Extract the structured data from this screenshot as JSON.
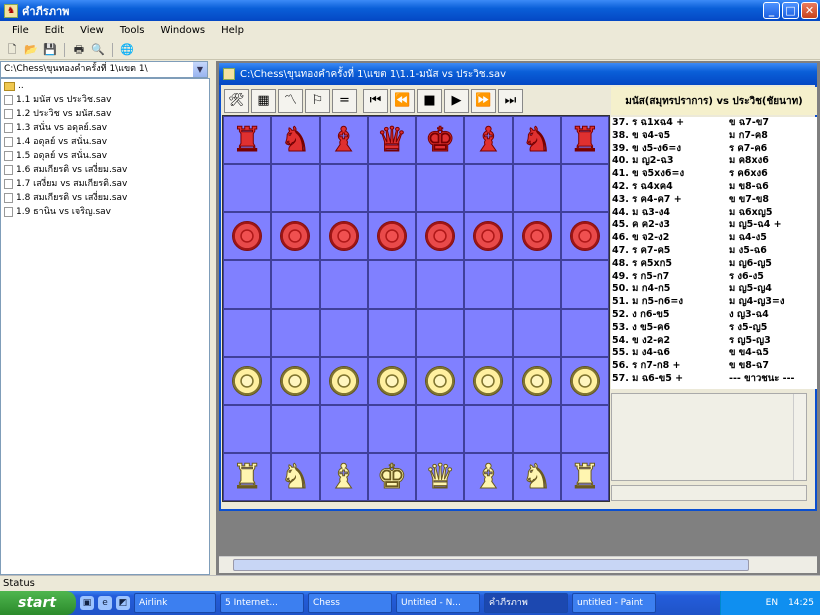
{
  "window": {
    "title": "คำภีรภาพ"
  },
  "menu": [
    "File",
    "Edit",
    "View",
    "Tools",
    "Windows",
    "Help"
  ],
  "left_pane": {
    "path": "C:\\Chess\\ขุนทองคำครั้งที่ 1\\แขต 1\\",
    "files": [
      {
        "name": "..",
        "icon": "folder-up-icon"
      },
      {
        "name": "1.1 มนัส vs ประวิช.sav",
        "icon": "file-icon"
      },
      {
        "name": "1.2 ประวิช vs มนัส.sav",
        "icon": "file-icon"
      },
      {
        "name": "1.3 สนั่น vs อดุลย์.sav",
        "icon": "file-icon"
      },
      {
        "name": "1.4 อดุลย์ vs สนั่น.sav",
        "icon": "file-icon"
      },
      {
        "name": "1.5 อดุลย์ vs สนั่น.sav",
        "icon": "file-icon"
      },
      {
        "name": "1.6 สมเกียรติ vs เสงี่ยม.sav",
        "icon": "file-icon"
      },
      {
        "name": "1.7 เสงี่ยม vs สมเกียรติ.sav",
        "icon": "file-icon"
      },
      {
        "name": "1.8 สมเกียรติ vs เสงี่ยม.sav",
        "icon": "file-icon"
      },
      {
        "name": "1.9 ธานิน vs เจริญ.sav",
        "icon": "file-icon"
      }
    ]
  },
  "game_window": {
    "title": "C:\\Chess\\ขุนทองคำครั้งที่ 1\\แขต 1\\1.1-มนัส vs ประวิช.sav",
    "players": "มนัส(สมุทรปราการ)  vs  ประวิช(ชัยนาท)",
    "controls": [
      {
        "icon": "tools-icon",
        "glyph": "🛠"
      },
      {
        "icon": "grid-icon",
        "glyph": "▦"
      },
      {
        "icon": "graph-icon",
        "glyph": "〽"
      },
      {
        "icon": "flag-icon",
        "glyph": "⚐"
      },
      {
        "icon": "draw-icon",
        "glyph": "="
      },
      {
        "icon": "first-move-icon",
        "glyph": "⏮"
      },
      {
        "icon": "previous-move-icon",
        "glyph": "⏪"
      },
      {
        "icon": "stop-icon",
        "glyph": "■"
      },
      {
        "icon": "play-icon",
        "glyph": "▶"
      },
      {
        "icon": "next-move-icon",
        "glyph": "⏩"
      },
      {
        "icon": "last-move-icon",
        "glyph": "⏭"
      }
    ],
    "moves": [
      [
        "37. ร ฉ1xฉ4 +",
        "ข ฉ7-ข7"
      ],
      [
        "38. ข จ4-จ5",
        "ม ก7-ค8"
      ],
      [
        "39. ข ง5-ง6=ง",
        "ร ค7-ค6"
      ],
      [
        "40. ม ญ2-ฉ3",
        "ม ค8xง6"
      ],
      [
        "41. ข จ5xง6=ง",
        "ร ค6xง6"
      ],
      [
        "42. ร ฉ4xค4",
        "ม ข8-ฉ6"
      ],
      [
        "43. ร ค4-ค7 +",
        "ข ข7-ข8"
      ],
      [
        "44. ม ฉ3-ง4",
        "ม ฉ6xญ5"
      ],
      [
        "45. ค ค2-ง3",
        "ม ญ5-ฉ4 +"
      ],
      [
        "46. ข จ2-ง2",
        "ม ฉ4-ง5"
      ],
      [
        "47. ร ค7-ค5",
        "ม ง5-ฉ6"
      ],
      [
        "48. ร ค5xก5",
        "ม ญ6-ญ5"
      ],
      [
        "49. ร ก5-ก7",
        "ร ง6-ง5"
      ],
      [
        "50. ม ก4-ก5",
        "ม ญ5-ญ4"
      ],
      [
        "51. ม ก5-ก6=ง",
        "ม ญ4-ญ3=ง"
      ],
      [
        "52. ง ก6-ข5",
        "ง ญ3-ฉ4"
      ],
      [
        "53. ง ข5-ค6",
        "ร ง5-ญ5"
      ],
      [
        "54. ข ง2-ค2",
        "ร ญ5-ญ3"
      ],
      [
        "55. ม ง4-ฉ6",
        "ข ข4-ฉ5"
      ],
      [
        "56. ร ก7-ก8 +",
        "ข ข8-ฉ7"
      ],
      [
        "57. ม ฉ6-ข5 +",
        "--- ขาวชนะ ---"
      ]
    ]
  },
  "board": {
    "rows": [
      [
        "red-boat",
        "red-horse",
        "red-noble",
        "red-queen",
        "red-king",
        "red-noble",
        "red-horse",
        "red-boat"
      ],
      [
        "",
        "",
        "",
        "",
        "",
        "",
        "",
        ""
      ],
      [
        "red-pawn",
        "red-pawn",
        "red-pawn",
        "red-pawn",
        "red-pawn",
        "red-pawn",
        "red-pawn",
        "red-pawn"
      ],
      [
        "",
        "",
        "",
        "",
        "",
        "",
        "",
        ""
      ],
      [
        "",
        "",
        "",
        "",
        "",
        "",
        "",
        ""
      ],
      [
        "yel-pawn",
        "yel-pawn",
        "yel-pawn",
        "yel-pawn",
        "yel-pawn",
        "yel-pawn",
        "yel-pawn",
        "yel-pawn"
      ],
      [
        "",
        "",
        "",
        "",
        "",
        "",
        "",
        ""
      ],
      [
        "yel-boat",
        "yel-horse",
        "yel-noble",
        "yel-king",
        "yel-queen",
        "yel-noble",
        "yel-horse",
        "yel-boat"
      ]
    ],
    "colors": {
      "board": "#8080ff",
      "red": "#e03030",
      "yellow": "#fff5b0"
    }
  },
  "status": {
    "text": "Status"
  },
  "taskbar": {
    "start": "start",
    "tasks": [
      "Airlink",
      "5 Internet...",
      "Chess",
      "Untitled - N...",
      "คำภีรภาพ",
      "untitled - Paint"
    ],
    "language": "EN",
    "clock": "14:25"
  }
}
